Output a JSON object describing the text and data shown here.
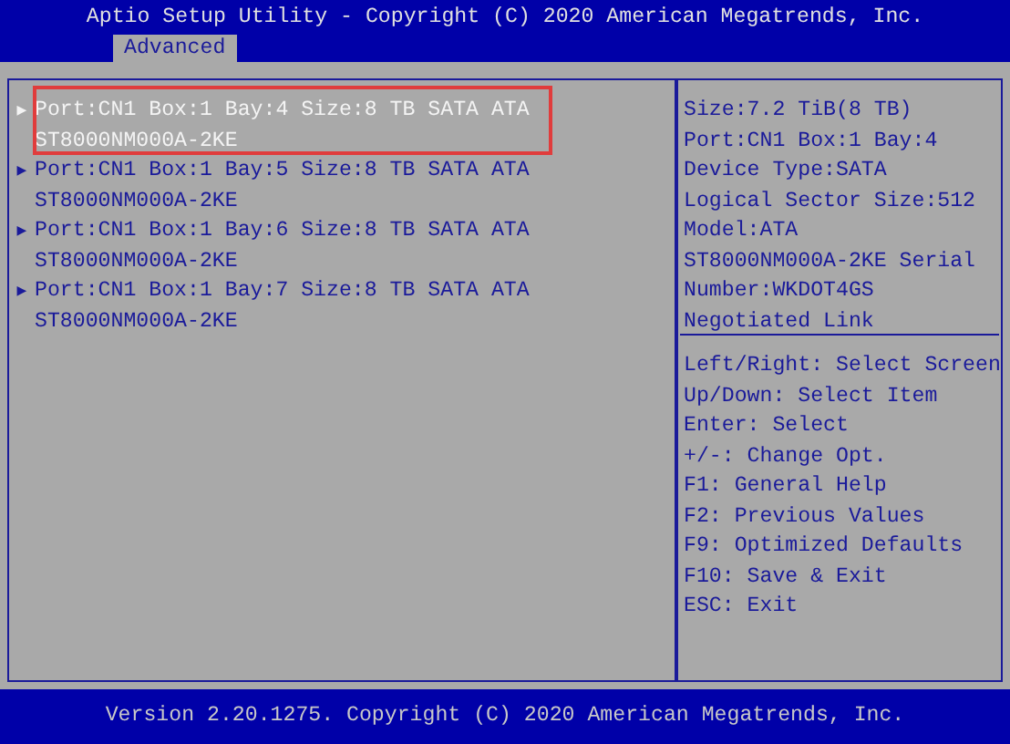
{
  "header": {
    "title": "Aptio Setup Utility - Copyright (C) 2020 American Megatrends, Inc."
  },
  "tabs": [
    {
      "label": "Advanced",
      "selected": true
    }
  ],
  "items": [
    {
      "arrow": "▶",
      "text": "Port:CN1 Box:1 Bay:4 Size:8 TB SATA ATA ST8000NM000A-2KE",
      "selected": true
    },
    {
      "arrow": "▶",
      "text": "Port:CN1 Box:1 Bay:5 Size:8 TB SATA ATA ST8000NM000A-2KE",
      "selected": false
    },
    {
      "arrow": "▶",
      "text": "Port:CN1 Box:1 Bay:6 Size:8 TB SATA ATA ST8000NM000A-2KE",
      "selected": false
    },
    {
      "arrow": "▶",
      "text": "Port:CN1 Box:1 Bay:7 Size:8 TB SATA ATA ST8000NM000A-2KE",
      "selected": false
    }
  ],
  "description": [
    "Size:7.2 TiB(8 TB)",
    "Port:CN1 Box:1 Bay:4",
    "Device Type:SATA",
    "Logical Sector Size:512",
    "Model:ATA",
    "ST8000NM000A-2KE Serial",
    "Number:WKDOT4GS",
    "Negotiated Link"
  ],
  "key_help": [
    "Left/Right: Select Screen",
    "Up/Down: Select Item",
    "Enter: Select",
    "+/-: Change Opt.",
    "F1: General Help",
    "F2: Previous Values",
    "F9: Optimized Defaults",
    "F10: Save & Exit",
    "ESC: Exit"
  ],
  "footer": {
    "text": "Version 2.20.1275. Copyright (C) 2020 American Megatrends, Inc."
  }
}
